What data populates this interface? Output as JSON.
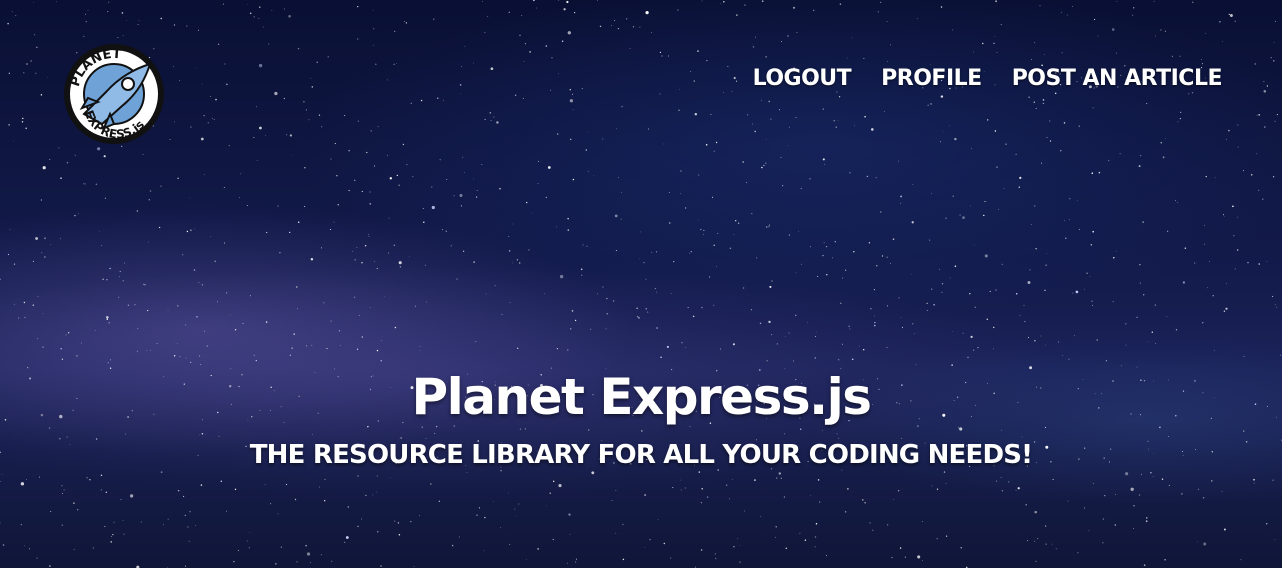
{
  "logo": {
    "text_top": "PLANET",
    "text_bottom": "EXPRESS.js",
    "tagline": "OUR CREW IS REPLACEABLE"
  },
  "nav": {
    "items": [
      {
        "label": "LOGOUT"
      },
      {
        "label": "PROFILE"
      },
      {
        "label": "POST AN ARTICLE"
      }
    ]
  },
  "hero": {
    "title": "Planet Express.js",
    "subtitle": "THE RESOURCE LIBRARY FOR ALL YOUR CODING NEEDS!"
  },
  "colors": {
    "text": "#ffffff",
    "sky_dark": "#0a1034",
    "milky_way": "#7869be",
    "logo_blue": "#6fa3d8"
  }
}
